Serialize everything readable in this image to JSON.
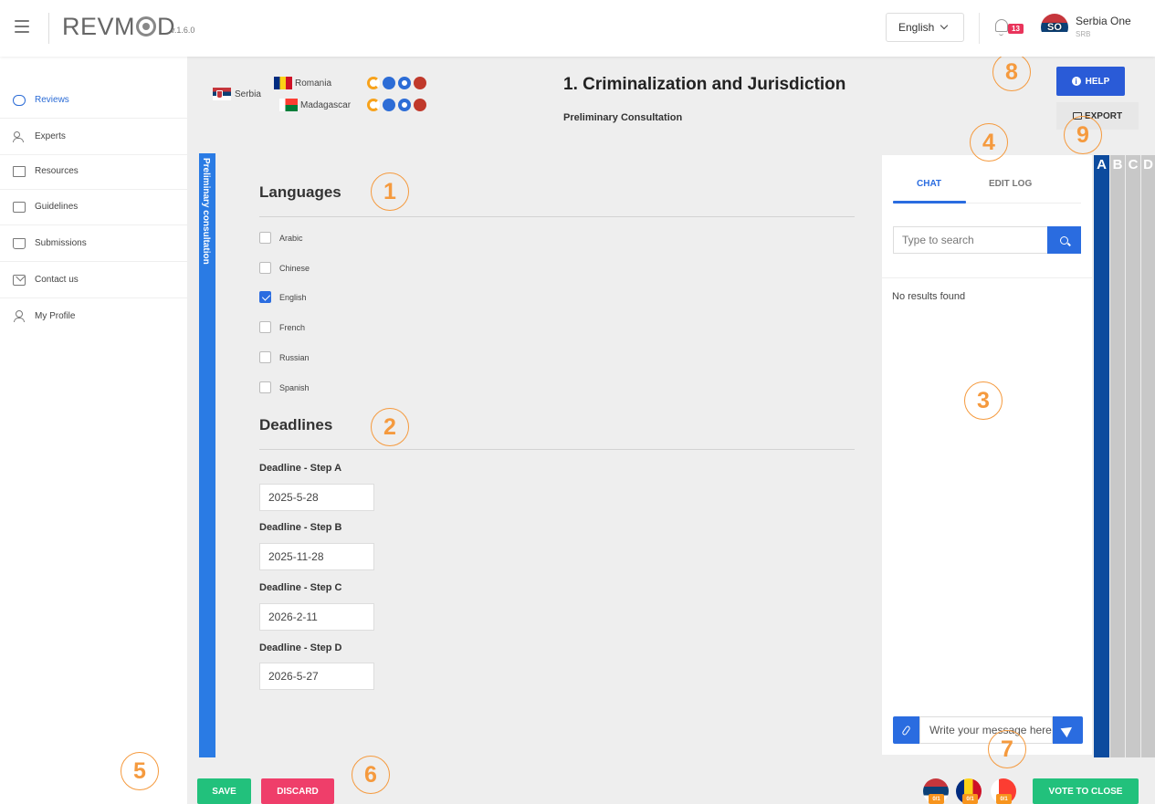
{
  "app": {
    "name_prefix": "REVM",
    "name_suffix": "D",
    "version": "v.1.6.0"
  },
  "header": {
    "language": "English",
    "notifications_count": "13",
    "user": {
      "initials": "SO",
      "name": "Serbia One",
      "sub": "SRB"
    }
  },
  "sidebar": {
    "items": [
      {
        "label": "Reviews"
      },
      {
        "label": "Experts"
      },
      {
        "label": "Resources"
      },
      {
        "label": "Guidelines"
      },
      {
        "label": "Submissions"
      },
      {
        "label": "Contact us"
      },
      {
        "label": "My Profile"
      }
    ]
  },
  "review": {
    "country": "Serbia",
    "reviewers": [
      {
        "name": "Romania"
      },
      {
        "name": "Madagascar"
      }
    ],
    "title": "1. Criminalization and Jurisdiction",
    "subtitle": "Preliminary Consultation",
    "vertical_tab": "Preliminary consultation"
  },
  "actions": {
    "help": "HELP",
    "export": "EXPORT",
    "save": "SAVE",
    "discard": "DISCARD",
    "vote": "VOTE TO CLOSE"
  },
  "languages": {
    "title": "Languages",
    "options": [
      {
        "label": "Arabic",
        "checked": false
      },
      {
        "label": "Chinese",
        "checked": false
      },
      {
        "label": "English",
        "checked": true
      },
      {
        "label": "French",
        "checked": false
      },
      {
        "label": "Russian",
        "checked": false
      },
      {
        "label": "Spanish",
        "checked": false
      }
    ]
  },
  "deadlines": {
    "title": "Deadlines",
    "items": [
      {
        "label": "Deadline - Step A",
        "value": "2025-5-28"
      },
      {
        "label": "Deadline - Step B",
        "value": "2025-11-28"
      },
      {
        "label": "Deadline - Step C",
        "value": "2026-2-11"
      },
      {
        "label": "Deadline - Step D",
        "value": "2026-5-27"
      }
    ]
  },
  "chat": {
    "tabs": [
      "CHAT",
      "EDIT LOG"
    ],
    "search_placeholder": "Type to search",
    "no_results": "No results found",
    "message_placeholder": "Write your message here"
  },
  "steps": [
    "A",
    "B",
    "C",
    "D"
  ],
  "votes": [
    "0/1",
    "0/1",
    "0/1"
  ],
  "annotations": [
    "1",
    "2",
    "3",
    "4",
    "5",
    "6",
    "7",
    "8",
    "9"
  ],
  "colors": {
    "primary": "#2a6ce0",
    "success": "#22c17c",
    "danger": "#ef3e6a",
    "annotation": "#f59a3e",
    "step_active": "#0d4b9e"
  }
}
